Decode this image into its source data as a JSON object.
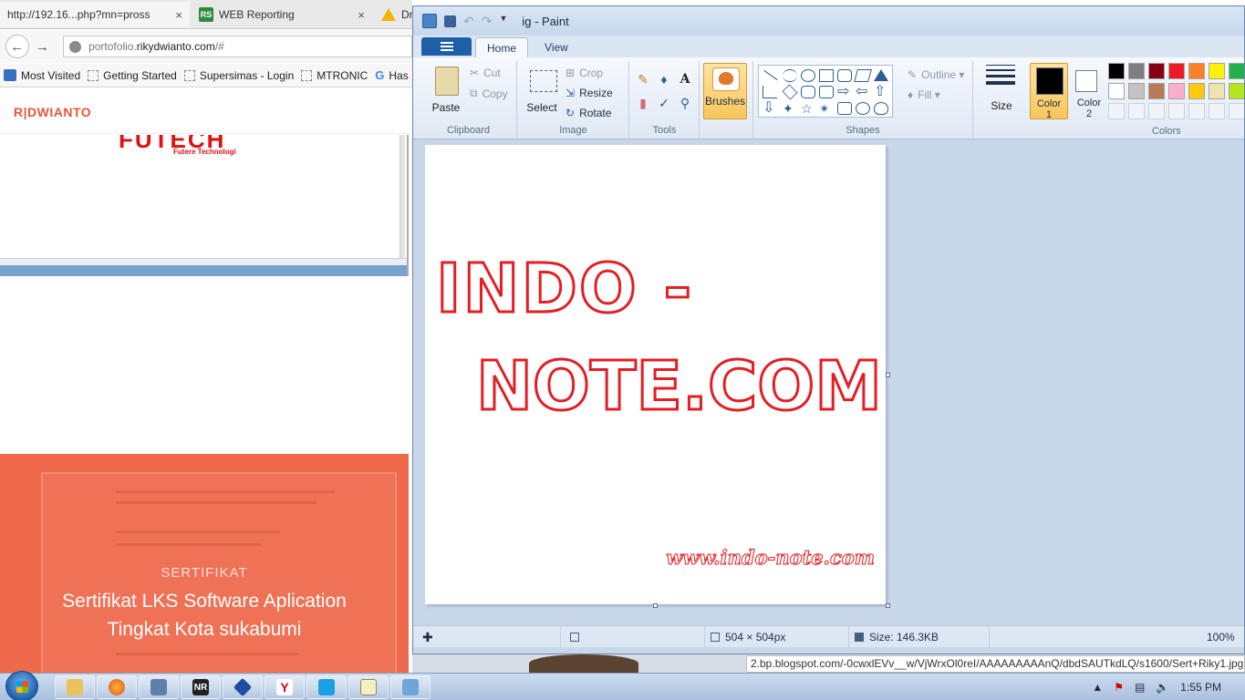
{
  "browser": {
    "tabs": [
      {
        "label": "http://192.16...php?mn=pross",
        "close": "×"
      },
      {
        "label": "WEB Reporting",
        "close": "×",
        "icon_text": "RS"
      },
      {
        "label": "Dri"
      }
    ],
    "url": {
      "prefix": "portofolio.",
      "domain": "rikydwianto.com",
      "suffix": "/#"
    },
    "bookmarks": [
      "Most Visited",
      "Getting Started",
      "Supersimas - Login",
      "MTRONIC",
      "Has"
    ],
    "site_logo": "R|DWIANTO",
    "embedded_logo": "FUTECH",
    "embedded_sub": "Futere Technologi",
    "certificate": {
      "label": "SERTIFIKAT",
      "title_line1": "Sertifikat LKS Software Aplication",
      "title_line2": "Tingkat Kota sukabumi"
    },
    "hover_url": "2.bp.blogspot.com/-0cwxlEVv__w/VjWrxOl0reI/AAAAAAAAAnQ/dbdSAUTkdLQ/s1600/Sert+Riky1.jpg"
  },
  "paint": {
    "title": "ig - Paint",
    "tabs": {
      "home": "Home",
      "view": "View"
    },
    "clipboard": {
      "paste": "Paste",
      "cut": "Cut",
      "copy": "Copy",
      "label": "Clipboard"
    },
    "image": {
      "select": "Select",
      "crop": "Crop",
      "resize": "Resize",
      "rotate": "Rotate",
      "label": "Image"
    },
    "tools": {
      "label": "Tools",
      "text_tool": "A"
    },
    "brushes": "Brushes",
    "shapes": {
      "outline": "Outline",
      "fill": "Fill",
      "label": "Shapes"
    },
    "size": "Size",
    "color1": {
      "line1": "Color",
      "line2": "1"
    },
    "color2": {
      "line1": "Color",
      "line2": "2"
    },
    "colors_label": "Colors",
    "palette": [
      "#000000",
      "#7f7f7f",
      "#880015",
      "#ed1c24",
      "#ff7f27",
      "#fff200",
      "#22b14c",
      "#ffffff",
      "#c3c3c3",
      "#b97a57",
      "#ffaec9",
      "#ffc90e",
      "#efe4b0",
      "#b5e61d"
    ],
    "canvas_text": {
      "line1": "INDO -",
      "line2": "NOTE.COM",
      "url": "www.indo-note.com"
    },
    "status": {
      "dimensions": "504 × 504px",
      "size": "Size: 146.3KB",
      "zoom": "100%"
    }
  },
  "taskbar": {
    "apps": [
      "explorer",
      "firefox",
      "network",
      "NR",
      "app",
      "Y",
      "skype",
      "notepad",
      "paint"
    ],
    "clock": "1:55 PM"
  }
}
